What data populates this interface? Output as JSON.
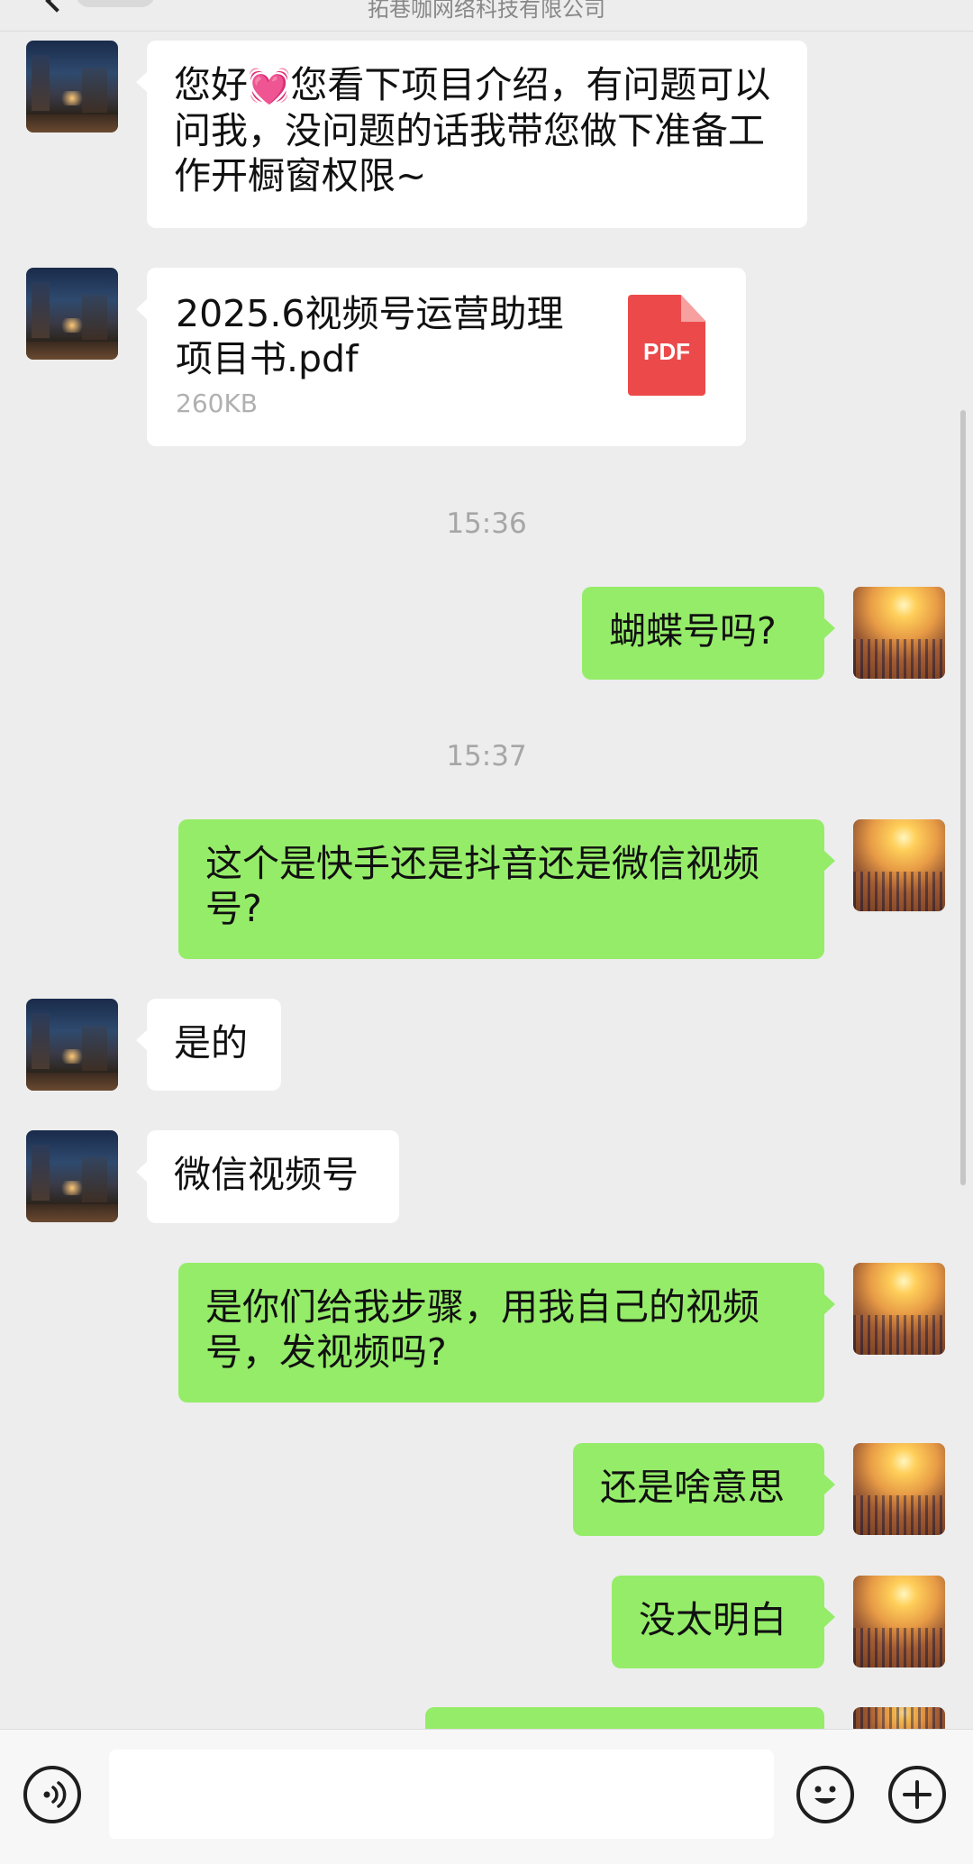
{
  "header": {
    "subtitle": "拓巷咖网络科技有限公司"
  },
  "icons": {
    "back": "chevron-left-icon",
    "voice": "voice-icon",
    "emoji": "smiley-icon",
    "plus": "plus-icon",
    "file": "pdf-icon"
  },
  "colors": {
    "outgoing_bubble": "#95ec69",
    "incoming_bubble": "#ffffff",
    "background": "#ededed",
    "pdf_red": "#ec4a4a"
  },
  "messages": {
    "m1": {
      "from": "contact",
      "text_a": "您好",
      "emoji": "💓",
      "text_b": "您看下项目介绍，有问题可以问我，没问题的话我带您做下准备工作开橱窗权限~"
    },
    "m2": {
      "from": "contact",
      "file_name": "2025.6视频号运营助理项目书.pdf",
      "file_size": "260KB",
      "file_type_label": "PDF"
    },
    "t1": "15:36",
    "m3": {
      "from": "me",
      "text": "蝴蝶号吗?"
    },
    "t2": "15:37",
    "m4": {
      "from": "me",
      "text": "这个是快手还是抖音还是微信视频号?"
    },
    "m5": {
      "from": "contact",
      "text": "是的"
    },
    "m6": {
      "from": "contact",
      "text": "微信视频号"
    },
    "m7": {
      "from": "me",
      "text": "是你们给我步骤，用我自己的视频号，发视频吗?"
    },
    "m8": {
      "from": "me",
      "text": "还是啥意思"
    },
    "m9": {
      "from": "me",
      "text": "没太明白"
    }
  },
  "input": {
    "value": ""
  }
}
